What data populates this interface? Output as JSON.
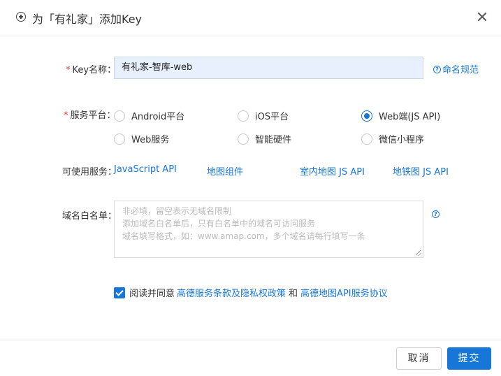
{
  "dialog": {
    "title": "为「有礼家」添加Key"
  },
  "form": {
    "key_name": {
      "label": "Key名称：",
      "required_mark": "*",
      "value": "有礼家-智库-web",
      "help_link": "命名规范"
    },
    "platform": {
      "label": "服务平台：",
      "required_mark": "*",
      "options": [
        {
          "label": "Android平台",
          "checked": false
        },
        {
          "label": "iOS平台",
          "checked": false
        },
        {
          "label": "Web端(JS API)",
          "checked": true
        },
        {
          "label": "Web服务",
          "checked": false
        },
        {
          "label": "智能硬件",
          "checked": false
        },
        {
          "label": "微信小程序",
          "checked": false
        }
      ]
    },
    "services": {
      "label": "可使用服务：",
      "items": [
        "JavaScript API",
        "地图组件",
        "室内地图 JS API",
        "地铁图 JS API"
      ]
    },
    "domain_whitelist": {
      "label": "域名白名单：",
      "placeholder_lines": [
        "非必填，留空表示无域名限制",
        "添加域名白名单后，只有白名单中的域名可访问服务",
        "域名填写格式，如：www.amap.com，多个域名请每行填写一条"
      ]
    },
    "agreement": {
      "checked": true,
      "prefix": "阅读并同意",
      "link1": "高德服务条款及隐私权政策",
      "conjunction": "和",
      "link2": "高德地图API服务协议"
    }
  },
  "footer": {
    "cancel_label": "取消",
    "submit_label": "提交"
  },
  "colors": {
    "accent": "#1677d9",
    "required": "#e4393c",
    "input_fill": "#e8f0fe"
  }
}
